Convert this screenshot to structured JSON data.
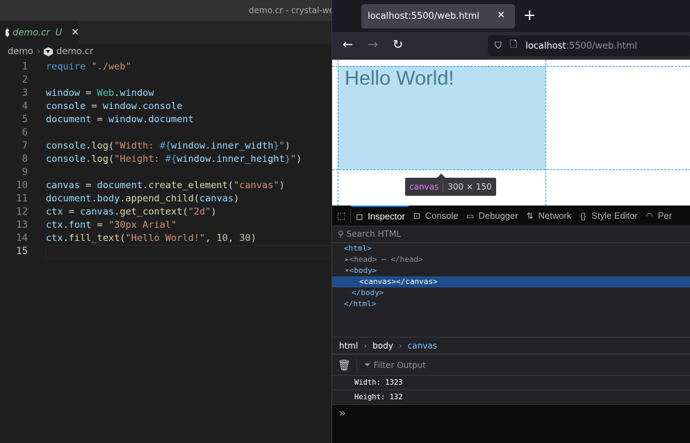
{
  "editor": {
    "window_title": "demo.cr - crystal-web",
    "tab": {
      "name": "demo.cr",
      "status": "U",
      "close": "✕"
    },
    "breadcrumb": [
      "demo",
      "demo.cr"
    ],
    "lines": [
      [
        [
          "require",
          "kw"
        ],
        [
          " ",
          "p"
        ],
        [
          "\"./web\"",
          "str"
        ]
      ],
      [],
      [
        [
          "window",
          "var"
        ],
        [
          " = ",
          "p"
        ],
        [
          "Web",
          "cls"
        ],
        [
          ".",
          "p"
        ],
        [
          "window",
          "var"
        ]
      ],
      [
        [
          "console",
          "var"
        ],
        [
          " = ",
          "p"
        ],
        [
          "window",
          "var"
        ],
        [
          ".",
          "p"
        ],
        [
          "console",
          "var"
        ]
      ],
      [
        [
          "document",
          "var"
        ],
        [
          " = ",
          "p"
        ],
        [
          "window",
          "var"
        ],
        [
          ".",
          "p"
        ],
        [
          "document",
          "var"
        ]
      ],
      [],
      [
        [
          "console",
          "var"
        ],
        [
          ".",
          "p"
        ],
        [
          "log",
          "fn"
        ],
        [
          "(",
          "p"
        ],
        [
          "\"Width: ",
          "str"
        ],
        [
          "#{",
          "in"
        ],
        [
          "window",
          "var"
        ],
        [
          ".",
          "p"
        ],
        [
          "inner_width",
          "var"
        ],
        [
          "}",
          "in"
        ],
        [
          "\"",
          "str"
        ],
        [
          ")",
          "p"
        ]
      ],
      [
        [
          "console",
          "var"
        ],
        [
          ".",
          "p"
        ],
        [
          "log",
          "fn"
        ],
        [
          "(",
          "p"
        ],
        [
          "\"Height: ",
          "str"
        ],
        [
          "#{",
          "in"
        ],
        [
          "window",
          "var"
        ],
        [
          ".",
          "p"
        ],
        [
          "inner_height",
          "var"
        ],
        [
          "}",
          "in"
        ],
        [
          "\"",
          "str"
        ],
        [
          ")",
          "p"
        ]
      ],
      [],
      [
        [
          "canvas",
          "var"
        ],
        [
          " = ",
          "p"
        ],
        [
          "document",
          "var"
        ],
        [
          ".",
          "p"
        ],
        [
          "create_element",
          "fn"
        ],
        [
          "(",
          "p"
        ],
        [
          "\"canvas\"",
          "str"
        ],
        [
          ")",
          "p"
        ]
      ],
      [
        [
          "document",
          "var"
        ],
        [
          ".",
          "p"
        ],
        [
          "body",
          "var"
        ],
        [
          ".",
          "p"
        ],
        [
          "append_child",
          "fn"
        ],
        [
          "(",
          "p"
        ],
        [
          "canvas",
          "var"
        ],
        [
          ")",
          "p"
        ]
      ],
      [
        [
          "ctx",
          "var"
        ],
        [
          " = ",
          "p"
        ],
        [
          "canvas",
          "var"
        ],
        [
          ".",
          "p"
        ],
        [
          "get_context",
          "fn"
        ],
        [
          "(",
          "p"
        ],
        [
          "\"2d\"",
          "str"
        ],
        [
          ")",
          "p"
        ]
      ],
      [
        [
          "ctx",
          "var"
        ],
        [
          ".",
          "p"
        ],
        [
          "font",
          "var"
        ],
        [
          " = ",
          "p"
        ],
        [
          "\"30px Arial\"",
          "str"
        ]
      ],
      [
        [
          "ctx",
          "var"
        ],
        [
          ".",
          "p"
        ],
        [
          "fill_text",
          "fn"
        ],
        [
          "(",
          "p"
        ],
        [
          "\"Hello World!\"",
          "str"
        ],
        [
          ", ",
          "p"
        ],
        [
          "10",
          "num"
        ],
        [
          ", ",
          "p"
        ],
        [
          "30",
          "num"
        ],
        [
          ")",
          "p"
        ]
      ],
      []
    ],
    "current_line": 15
  },
  "browser": {
    "tab_title": "localhost:5500/web.html",
    "tab_close": "✕",
    "new_tab": "+",
    "url_host": "localhost",
    "url_rest": ":5500/web.html",
    "canvas_text": "Hello World!",
    "tooltip": {
      "tag": "canvas",
      "dims": "300 × 150"
    }
  },
  "devtools": {
    "tabs": [
      "Inspector",
      "Console",
      "Debugger",
      "Network",
      "Style Editor",
      "Per"
    ],
    "search_placeholder": "Search HTML",
    "tree": {
      "html": "<html>",
      "head_open": "<head>",
      "head_close": "</head>",
      "body": "<body>",
      "canvas": "<canvas></canvas>",
      "body_close": "</body>",
      "html_close": "</html>"
    },
    "breadcrumb": [
      "html",
      "body",
      "canvas"
    ],
    "filter_placeholder": "Filter Output",
    "messages": [
      "Width: 1323",
      "Height: 132"
    ],
    "prompt": "»"
  }
}
